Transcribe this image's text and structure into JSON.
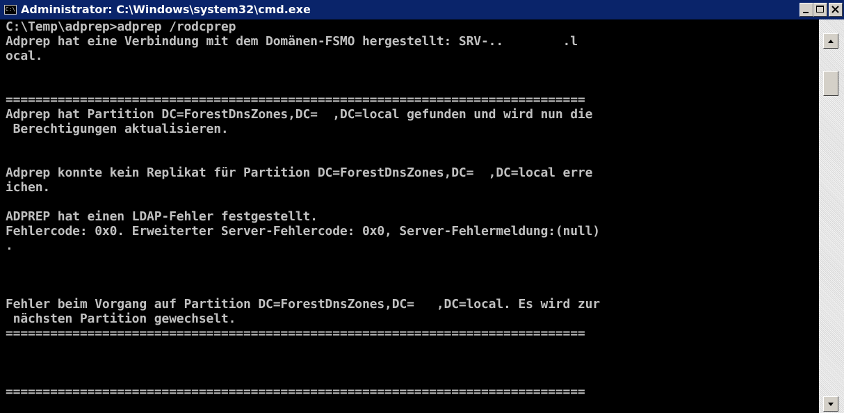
{
  "window": {
    "title": "Administrator: C:\\Windows\\system32\\cmd.exe",
    "icon": "console-icon",
    "icon_text": "C:\\",
    "controls": [
      "minimize-icon",
      "maximize-icon",
      "close-icon"
    ]
  },
  "console": {
    "text_color": "#c0c0c0",
    "background": "#000000",
    "lines": [
      "C:\\Temp\\adprep>adprep /rodcprep",
      "Adprep hat eine Verbindung mit dem Domänen-FSMO hergestellt: SRV-..        .l",
      "ocal.",
      "",
      "",
      "==============================================================================",
      "Adprep hat Partition DC=ForestDnsZones,DC=  ,DC=local gefunden und wird nun die",
      " Berechtigungen aktualisieren.",
      "",
      "",
      "Adprep konnte kein Replikat für Partition DC=ForestDnsZones,DC=  ,DC=local erre",
      "ichen.",
      "",
      "ADPREP hat einen LDAP-Fehler festgestellt.",
      "Fehlercode: 0x0. Erweiterter Server-Fehlercode: 0x0, Server-Fehlermeldung:(null)",
      ".",
      "",
      "",
      "",
      "Fehler beim Vorgang auf Partition DC=ForestDnsZones,DC=   ,DC=local. Es wird zur",
      " nächsten Partition gewechselt.",
      "==============================================================================",
      "",
      "",
      "",
      "=============================================================================="
    ]
  },
  "scrollbar": {
    "up_icon": "arrow-up-icon",
    "down_icon": "arrow-down-icon",
    "position_fraction": 0.1
  }
}
